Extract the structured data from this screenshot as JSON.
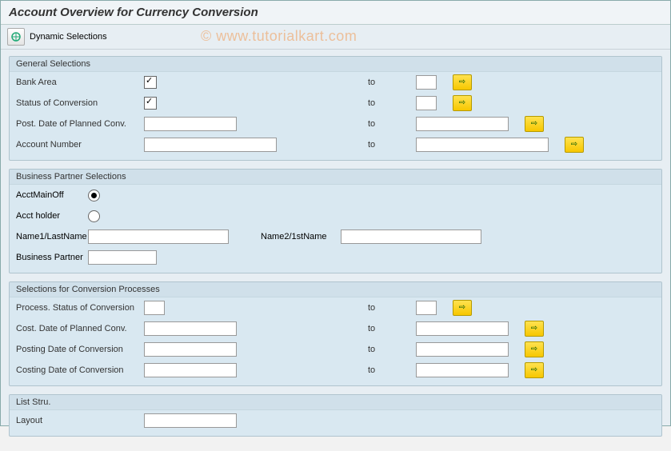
{
  "title": "Account Overview for Currency Conversion",
  "toolbar": {
    "dynamic_selections": "Dynamic Selections"
  },
  "watermark": "© www.tutorialkart.com",
  "group1": {
    "title": "General Selections",
    "bank_area": "Bank Area",
    "status_conv": "Status of Conversion",
    "post_date": "Post. Date of Planned Conv.",
    "account_number": "Account Number",
    "to": "to"
  },
  "group2": {
    "title": "Business Partner Selections",
    "acct_main_off": "AcctMainOff",
    "acct_holder": "Acct holder",
    "name1": "Name1/LastName",
    "name2": "Name2/1stName",
    "bp": "Business Partner"
  },
  "group3": {
    "title": "Selections for Conversion Processes",
    "process_status": "Process. Status of Conversion",
    "cost_date": "Cost. Date of Planned Conv.",
    "posting_date": "Posting Date of Conversion",
    "costing_date": "Costing Date of Conversion",
    "to": "to"
  },
  "group4": {
    "title": "List Stru.",
    "layout": "Layout"
  }
}
